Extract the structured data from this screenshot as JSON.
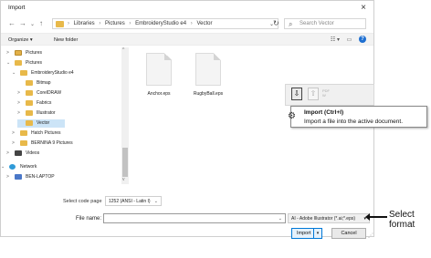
{
  "window": {
    "title": "Import",
    "close_glyph": "×"
  },
  "nav": {
    "back": "←",
    "forward": "→",
    "dropdown": "⌄",
    "up": "↑",
    "breadcrumbs": [
      "Libraries",
      "Pictures",
      "EmbroideryStudio e4",
      "Vector"
    ],
    "crumb_sep": "›",
    "address_dropdown": "⌄",
    "refresh": "↻",
    "search_placeholder": "Search Vector",
    "search_icon": "⌕"
  },
  "commands": {
    "organize": "Organize ▾",
    "new_folder": "New folder",
    "view_icon": "☷ ▾",
    "pane_icon": "▭",
    "help": "?"
  },
  "tree": [
    {
      "label": "Pictures",
      "chev": ">",
      "icon": "pics"
    },
    {
      "label": "Pictures",
      "chev": "⌄",
      "icon": "folder"
    },
    {
      "label": "EmbroideryStudio e4",
      "chev": "⌄",
      "icon": "folder"
    },
    {
      "label": "Bitmap",
      "chev": "",
      "icon": "folder"
    },
    {
      "label": "CorelDRAW",
      "chev": ">",
      "icon": "folder"
    },
    {
      "label": "Fabrics",
      "chev": ">",
      "icon": "folder"
    },
    {
      "label": "Illustrator",
      "chev": ">",
      "icon": "folder"
    },
    {
      "label": "Vector",
      "chev": "",
      "icon": "folder",
      "selected": true
    },
    {
      "label": "Hatch Pictures",
      "chev": ">",
      "icon": "folder"
    },
    {
      "label": "BERNINA 9 Pictures",
      "chev": ">",
      "icon": "folder"
    },
    {
      "label": "Videos",
      "chev": ">",
      "icon": "video"
    },
    {
      "label": "Network",
      "chev": "⌄",
      "icon": "network"
    },
    {
      "label": "BEN-LAPTOP",
      "chev": ">",
      "icon": "computer"
    }
  ],
  "files": [
    {
      "name": "Anchor.eps"
    },
    {
      "name": "RugbyBall.eps"
    }
  ],
  "import_toolbar": {
    "import_glyph": "⇩",
    "export_glyph": "⇧",
    "pdf_label": "PDF",
    "pdf_sub": "W"
  },
  "tooltip": {
    "title": "Import (Ctrl+I)",
    "description": "Import a file into the active document.",
    "gear": "⚙"
  },
  "encoding": {
    "label": "Select code page",
    "value": "1252  (ANSI - Latin I)",
    "dropdown": "⌄"
  },
  "filename": {
    "label": "File name:",
    "value": "",
    "dropdown": "⌄"
  },
  "filetype": {
    "value": "AI - Adobe Illustrator (*.ai;*.eps)",
    "dropdown": "▾"
  },
  "buttons": {
    "import": "Import",
    "import_split": "▾",
    "cancel": "Cancel"
  },
  "annotation": {
    "line1": "Select",
    "line2": "format"
  }
}
